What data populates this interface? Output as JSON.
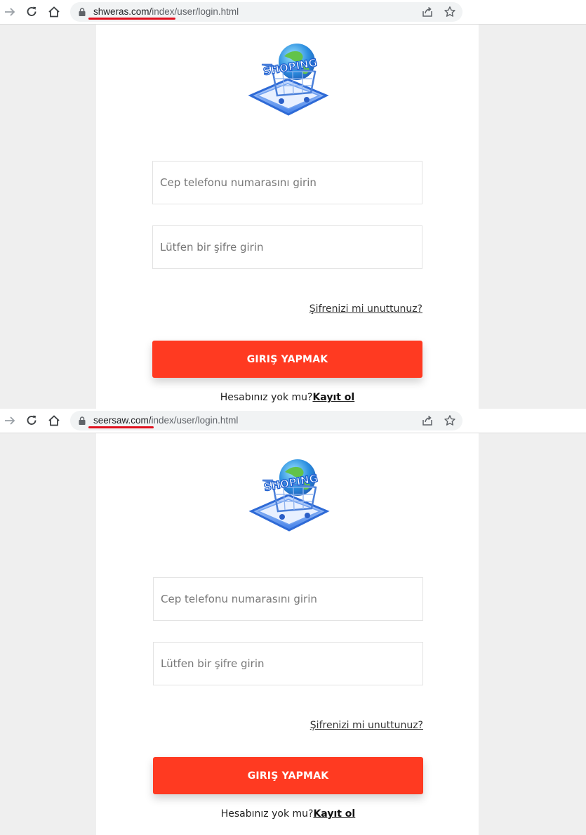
{
  "screens": [
    {
      "url_domain": "shweras.com/",
      "url_path": "index/user/login.html",
      "logo_text": "SHOPING",
      "phone_placeholder": "Cep telefonu numarasını girin",
      "password_placeholder": "Lütfen bir şifre girin",
      "forgot_label": "Şifrenizi mi unuttunuz?",
      "login_label": "GIRIŞ YAPMAK",
      "no_account_text": "Hesabınız yok mu?",
      "signup_label": "Kayıt ol"
    },
    {
      "url_domain": "seersaw.com/",
      "url_path": "index/user/login.html",
      "logo_text": "SHOPING",
      "phone_placeholder": "Cep telefonu numarasını girin",
      "password_placeholder": "Lütfen bir şifre girin",
      "forgot_label": "Şifrenizi mi unuttunuz?",
      "login_label": "GIRIŞ YAPMAK",
      "no_account_text": "Hesabınız yok mu?",
      "signup_label": "Kayıt ol"
    }
  ],
  "colors": {
    "accent": "#ff3a21",
    "annotation_underline": "#e0101e",
    "page_background": "#efefef"
  },
  "icons": [
    "forward-arrow-icon",
    "reload-icon",
    "home-icon",
    "lock-icon",
    "share-icon",
    "star-icon",
    "shopping-cart-globe-logo"
  ]
}
